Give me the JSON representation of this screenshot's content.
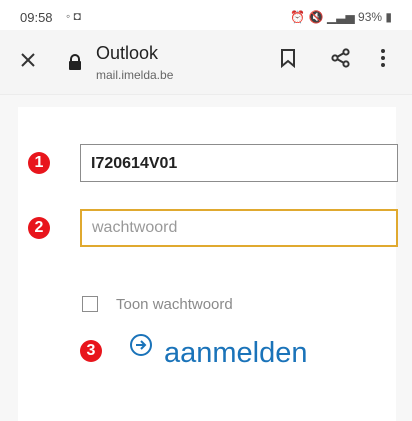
{
  "status_bar": {
    "time": "09:58",
    "battery": "93%"
  },
  "toolbar": {
    "title": "Outlook",
    "url": "mail.imelda.be"
  },
  "login_form": {
    "userid_value": "I720614V01",
    "password_placeholder": "wachtwoord",
    "show_password_label": "Toon wachtwoord",
    "submit_label": "aanmelden"
  },
  "annotations": {
    "one": "1",
    "two": "2",
    "three": "3"
  },
  "colors": {
    "accent_blue": "#1a73b9",
    "focus_border": "#e0a92f",
    "badge_red": "#e8151c"
  }
}
